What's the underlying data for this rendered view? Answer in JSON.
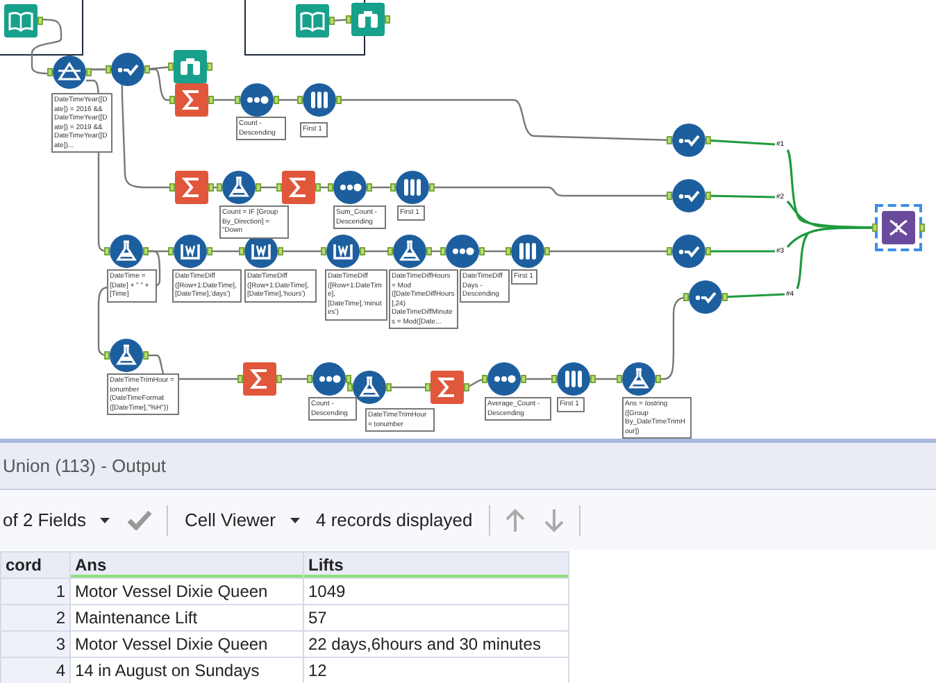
{
  "canvas": {
    "nodes": [
      {
        "kind": "book",
        "selected": false
      },
      {
        "kind": "book",
        "selected": false
      },
      {
        "kind": "binoculars",
        "selected": false
      },
      {
        "kind": "filter",
        "selected": false
      },
      {
        "kind": "select",
        "selected": false
      },
      {
        "kind": "binoculars",
        "selected": false
      },
      {
        "kind": "summarize",
        "selected": false
      },
      {
        "kind": "sort",
        "selected": false
      },
      {
        "kind": "sample",
        "selected": false
      },
      {
        "kind": "select",
        "selected": false
      },
      {
        "kind": "summarize",
        "selected": false
      },
      {
        "kind": "formula",
        "selected": false
      },
      {
        "kind": "summarize",
        "selected": false
      },
      {
        "kind": "sort",
        "selected": false
      },
      {
        "kind": "sample",
        "selected": false
      },
      {
        "kind": "select",
        "selected": false
      },
      {
        "kind": "union",
        "selected": true
      },
      {
        "kind": "formula",
        "selected": false
      },
      {
        "kind": "multirow",
        "selected": false
      },
      {
        "kind": "multirow",
        "selected": false
      },
      {
        "kind": "multirow",
        "selected": false
      },
      {
        "kind": "formula",
        "selected": false
      },
      {
        "kind": "sort",
        "selected": false
      },
      {
        "kind": "sample",
        "selected": false
      },
      {
        "kind": "select",
        "selected": false
      },
      {
        "kind": "select",
        "selected": false
      },
      {
        "kind": "formula",
        "selected": false
      },
      {
        "kind": "summarize",
        "selected": false
      },
      {
        "kind": "sort",
        "selected": false
      },
      {
        "kind": "formula",
        "selected": false
      },
      {
        "kind": "summarize",
        "selected": false
      },
      {
        "kind": "sort",
        "selected": false
      },
      {
        "kind": "sample",
        "selected": false
      },
      {
        "kind": "formula",
        "selected": false
      }
    ],
    "annotations": [
      {
        "text": "DateTimeYear([Date]) = 2016 && DateTimeYear([Date]) = 2019 && DateTimeYear([Date])..."
      },
      {
        "text": "Count - Descending"
      },
      {
        "text": "First 1"
      },
      {
        "text": "Count = IF [Group By_Direction] = \"Down"
      },
      {
        "text": "Sum_Count - Descending"
      },
      {
        "text": "First 1"
      },
      {
        "text": "DateTime = [Date] + \" \" + [Time]"
      },
      {
        "text": "DateTimeDiff ([Row+1:DateTime], [DateTime],'days')"
      },
      {
        "text": "DateTimeDiff ([Row+1:DateTime], [DateTime],'hours')"
      },
      {
        "text": "DateTimeDiff ([Row+1:DateTime], [DateTime],'minutes')"
      },
      {
        "text": "DateTimeDiffHours = Mod ([DateTimeDiffHours],24) DateTimeDiffMinutes = Mod([Date..."
      },
      {
        "text": "DateTimeDiffDays - Descending"
      },
      {
        "text": "First 1"
      },
      {
        "text": "DateTimeTrimHour = tonumber (DateTimeFormat ([DateTime],\"%H\"))"
      },
      {
        "text": "Count - Descending"
      },
      {
        "text": "DateTimeTrimHour = tonumber"
      },
      {
        "text": "Average_Count - Descending"
      },
      {
        "text": "First 1"
      },
      {
        "text": "Ans = tostring ([Group By_DateTimeTrimHour])"
      }
    ],
    "connection_labels": [
      "#1",
      "#2",
      "#3",
      "#4"
    ]
  },
  "results": {
    "title": "Union (113) - Output",
    "toolbar": {
      "fields_menu": "of 2 Fields",
      "viewer_menu": "Cell Viewer",
      "record_count": "4 records displayed"
    },
    "table": {
      "columns": [
        "cord",
        "Ans",
        "Lifts"
      ],
      "rows": [
        {
          "record": "1",
          "ans": "Motor Vessel Dixie Queen",
          "lifts": "1049"
        },
        {
          "record": "2",
          "ans": "Maintenance Lift",
          "lifts": "57"
        },
        {
          "record": "3",
          "ans": "Motor Vessel Dixie Queen",
          "lifts": "22 days,6hours and 30 minutes"
        },
        {
          "record": "4",
          "ans": "14 in August on Sundays",
          "lifts": "12"
        }
      ]
    }
  }
}
